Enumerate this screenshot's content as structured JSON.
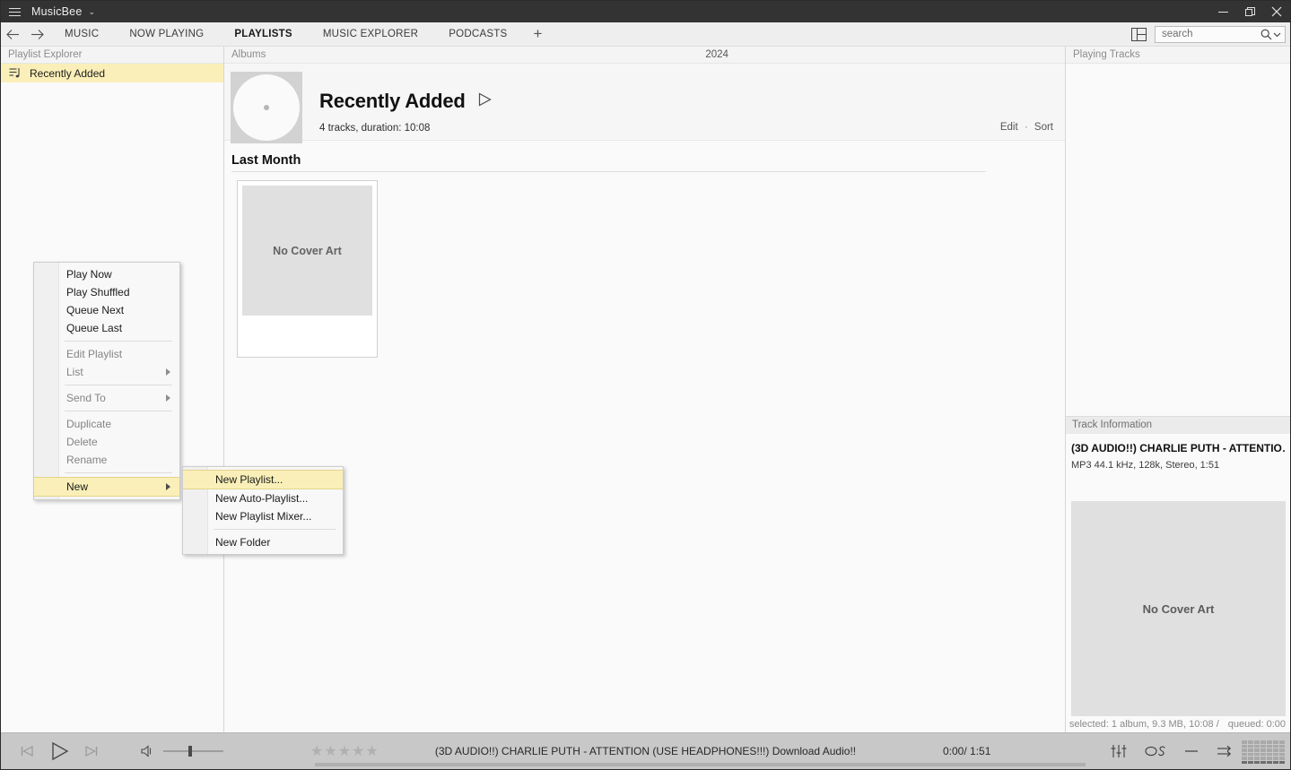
{
  "window": {
    "title": "MusicBee",
    "title_caret": "⌄",
    "minimize_icon": "minimize-icon",
    "restore_icon": "restore-icon",
    "close_icon": "close-icon"
  },
  "tabbar": {
    "back_icon": "back-arrow-icon",
    "forward_icon": "forward-arrow-icon",
    "tabs": [
      {
        "label": "MUSIC",
        "active": false
      },
      {
        "label": "NOW PLAYING",
        "active": false
      },
      {
        "label": "PLAYLISTS",
        "active": true
      },
      {
        "label": "MUSIC EXPLORER",
        "active": false
      },
      {
        "label": "PODCASTS",
        "active": false
      }
    ],
    "add_tab_label": "+",
    "layout_toggle_icon": "panel-layout-icon"
  },
  "search": {
    "placeholder": "search",
    "value": "",
    "icon": "search-icon",
    "caret_icon": "chevron-down-icon"
  },
  "sidebar": {
    "header": "Playlist Explorer",
    "items": [
      {
        "label": "Recently Added",
        "icon": "playlist-icon",
        "selected": true
      }
    ]
  },
  "center": {
    "header_left": "Albums",
    "header_year": "2024",
    "hero": {
      "title": "Recently Added",
      "play_icon": "play-triangle-icon",
      "subtitle": "4 tracks, duration: 10:08",
      "edit_label": "Edit",
      "separator": "·",
      "sort_label": "Sort",
      "art_placeholder_icon": "disc-icon"
    },
    "groups": [
      {
        "title": "Last Month",
        "albums": [
          {
            "cover_text": "No Cover Art",
            "title": "",
            "artist": ""
          }
        ]
      }
    ]
  },
  "right_panel": {
    "playing_tracks_header": "Playing Tracks",
    "track_information_header": "Track Information",
    "track_title": "(3D AUDIO!!) CHARLIE PUTH - ATTENTIO…",
    "track_meta": "MP3 44.1 kHz, 128k, Stereo, 1:51",
    "cover_placeholder": "No Cover Art",
    "status_selected": "selected: 1 album, 9.3 MB, 10:08 /",
    "status_queued": "queued: 0:00"
  },
  "player": {
    "prev_icon": "previous-track-icon",
    "play_icon": "play-icon",
    "next_icon": "next-track-icon",
    "volume_icon": "volume-icon",
    "volume_value": 42,
    "rating_stars": 0,
    "rating_max": 5,
    "now_playing": "(3D AUDIO!!) CHARLIE PUTH - ATTENTION (USE HEADPHONES!!!) Download Audio!!",
    "time_elapsed": "0:00",
    "time_separator": "/",
    "time_total": "1:51",
    "time_display": "0:00/ 1:51",
    "equalizer_icon": "equalizer-icon",
    "lastfm_icon": "lastfm-scrobble-icon",
    "repeat_icon": "repeat-off-icon",
    "shuffle_icon": "shuffle-icon",
    "visualizer_icon": "visualizer-icon",
    "progress_percent": 0
  },
  "context_menu": {
    "items": [
      {
        "label": "Play Now",
        "disabled": false,
        "submenu": false,
        "highlight": false
      },
      {
        "label": "Play Shuffled",
        "disabled": false,
        "submenu": false,
        "highlight": false
      },
      {
        "label": "Queue Next",
        "disabled": false,
        "submenu": false,
        "highlight": false
      },
      {
        "label": "Queue Last",
        "disabled": false,
        "submenu": false,
        "highlight": false
      },
      {
        "separator": true
      },
      {
        "label": "Edit Playlist",
        "disabled": true,
        "submenu": false,
        "highlight": false
      },
      {
        "label": "List",
        "disabled": true,
        "submenu": true,
        "highlight": false
      },
      {
        "separator": true
      },
      {
        "label": "Send To",
        "disabled": true,
        "submenu": true,
        "highlight": false
      },
      {
        "separator": true
      },
      {
        "label": "Duplicate",
        "disabled": true,
        "submenu": false,
        "highlight": false
      },
      {
        "label": "Delete",
        "disabled": true,
        "submenu": false,
        "highlight": false
      },
      {
        "label": "Rename",
        "disabled": true,
        "submenu": false,
        "highlight": false
      },
      {
        "separator": true
      },
      {
        "label": "New",
        "disabled": false,
        "submenu": true,
        "highlight": true
      }
    ],
    "submenu": {
      "items": [
        {
          "label": "New Playlist...",
          "highlight": true
        },
        {
          "label": "New Auto-Playlist...",
          "highlight": false
        },
        {
          "label": "New Playlist Mixer...",
          "highlight": false
        },
        {
          "separator": true
        },
        {
          "label": "New Folder",
          "highlight": false
        }
      ]
    }
  },
  "colors": {
    "titlebar": "#333333",
    "accent_highlight": "#faefb8",
    "player_bar": "#c8c8c8",
    "panel_bg": "#fafafa"
  }
}
